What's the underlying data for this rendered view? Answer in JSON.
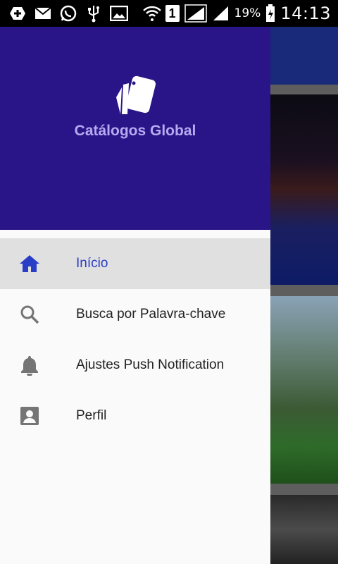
{
  "status_bar": {
    "battery_percent": "19%",
    "time": "14:13",
    "sim_label": "1",
    "icons_left": [
      "add-box-icon",
      "mail-icon",
      "whatsapp-icon",
      "usb-icon",
      "image-icon"
    ],
    "icons_right": [
      "wifi-icon",
      "sim-icon",
      "signal-icon",
      "signal-icon",
      "battery-icon"
    ]
  },
  "drawer": {
    "app_title": "Catálogos Global",
    "header_color": "#2a1588",
    "accent_color": "#2a3dc7",
    "menu": [
      {
        "label": "Início",
        "icon": "home-icon",
        "active": true
      },
      {
        "label": "Busca por Palavra-chave",
        "icon": "search-icon",
        "active": false
      },
      {
        "label": "Ajustes Push Notification",
        "icon": "bell-icon",
        "active": false
      },
      {
        "label": "Perfil",
        "icon": "account-box-icon",
        "active": false
      }
    ]
  }
}
